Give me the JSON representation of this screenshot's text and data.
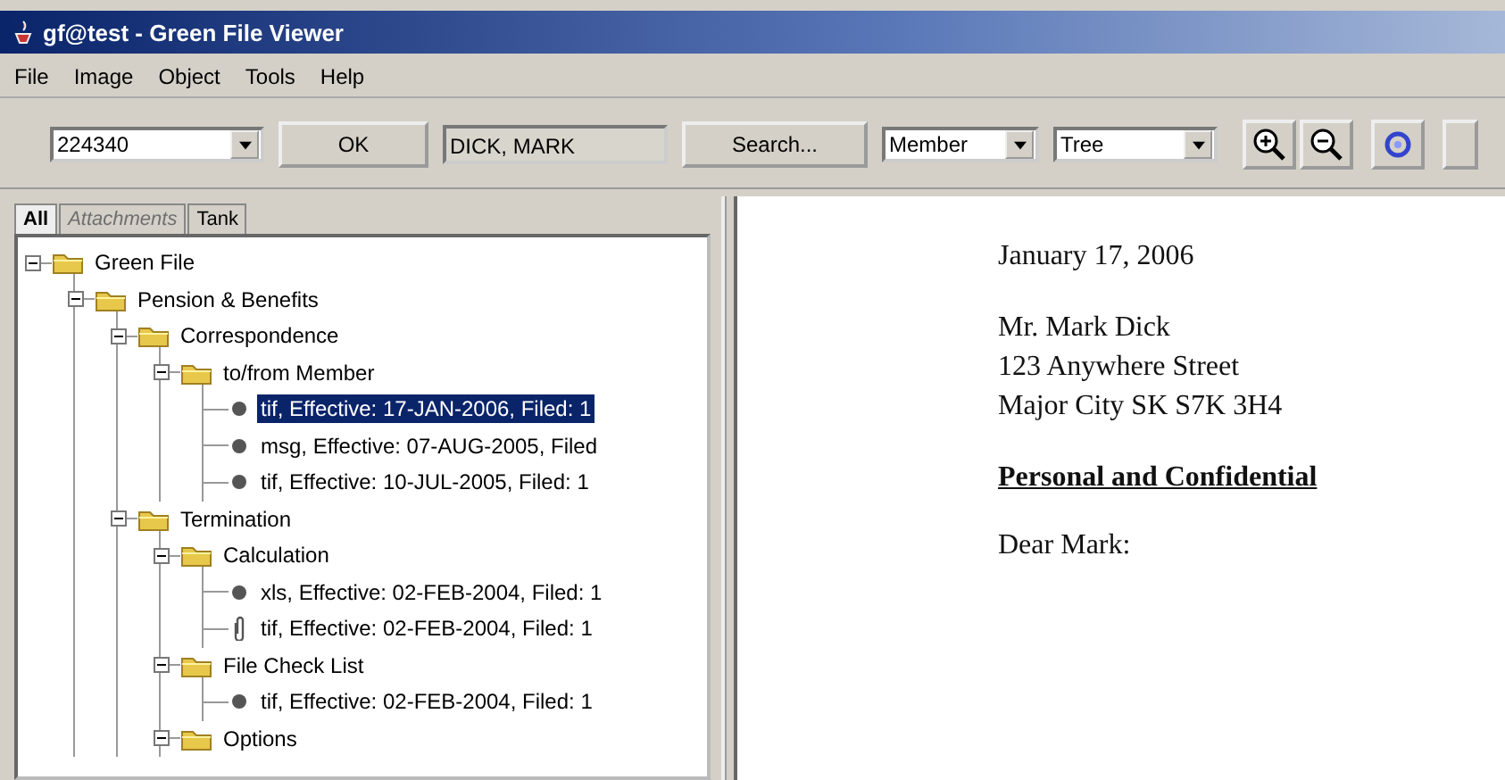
{
  "window": {
    "title": "gf@test - Green File Viewer"
  },
  "menu": [
    "File",
    "Image",
    "Object",
    "Tools",
    "Help"
  ],
  "toolbar": {
    "member_id": {
      "value": "224340"
    },
    "ok_button": "OK",
    "member_name": {
      "value": "DICK, MARK"
    },
    "search_button": "Search...",
    "type_select": {
      "value": "Member"
    },
    "view_select": {
      "value": "Tree"
    }
  },
  "tabs": [
    {
      "label": "All",
      "selected": true,
      "disabled": false
    },
    {
      "label": "Attachments",
      "selected": false,
      "disabled": true
    },
    {
      "label": "Tank",
      "selected": false,
      "disabled": false
    }
  ],
  "tree": [
    {
      "label": "Green File",
      "kind": "folder",
      "expanded": true,
      "selected": false,
      "children": [
        {
          "label": "Pension & Benefits",
          "kind": "folder",
          "expanded": true,
          "selected": false,
          "children": [
            {
              "label": "Correspondence",
              "kind": "folder",
              "expanded": true,
              "selected": false,
              "children": [
                {
                  "label": "to/from Member",
                  "kind": "folder",
                  "expanded": true,
                  "selected": false,
                  "children": [
                    {
                      "label": "tif, Effective: 17-JAN-2006, Filed: 1",
                      "kind": "document",
                      "selected": true
                    },
                    {
                      "label": "msg, Effective: 07-AUG-2005, Filed",
                      "kind": "document",
                      "selected": false
                    },
                    {
                      "label": "tif, Effective: 10-JUL-2005, Filed: 1",
                      "kind": "document",
                      "selected": false
                    }
                  ]
                }
              ]
            },
            {
              "label": "Termination",
              "kind": "folder",
              "expanded": true,
              "selected": false,
              "children": [
                {
                  "label": "Calculation",
                  "kind": "folder",
                  "expanded": true,
                  "selected": false,
                  "children": [
                    {
                      "label": "xls, Effective: 02-FEB-2004, Filed: 1",
                      "kind": "document",
                      "selected": false
                    },
                    {
                      "label": "tif, Effective: 02-FEB-2004, Filed: 1",
                      "kind": "attachment",
                      "selected": false
                    }
                  ]
                },
                {
                  "label": "File Check List",
                  "kind": "folder",
                  "expanded": true,
                  "selected": false,
                  "children": [
                    {
                      "label": "tif, Effective: 02-FEB-2004, Filed: 1",
                      "kind": "document",
                      "selected": false
                    }
                  ]
                },
                {
                  "label": "Options",
                  "kind": "folder",
                  "expanded": true,
                  "selected": false
                }
              ]
            }
          ]
        }
      ]
    }
  ],
  "document": {
    "date": "January 17, 2006",
    "address": [
      "Mr. Mark Dick",
      "123 Anywhere Street",
      "Major City SK S7K 3H4"
    ],
    "subject": "Personal and Confidential",
    "salutation": "Dear Mark:"
  }
}
